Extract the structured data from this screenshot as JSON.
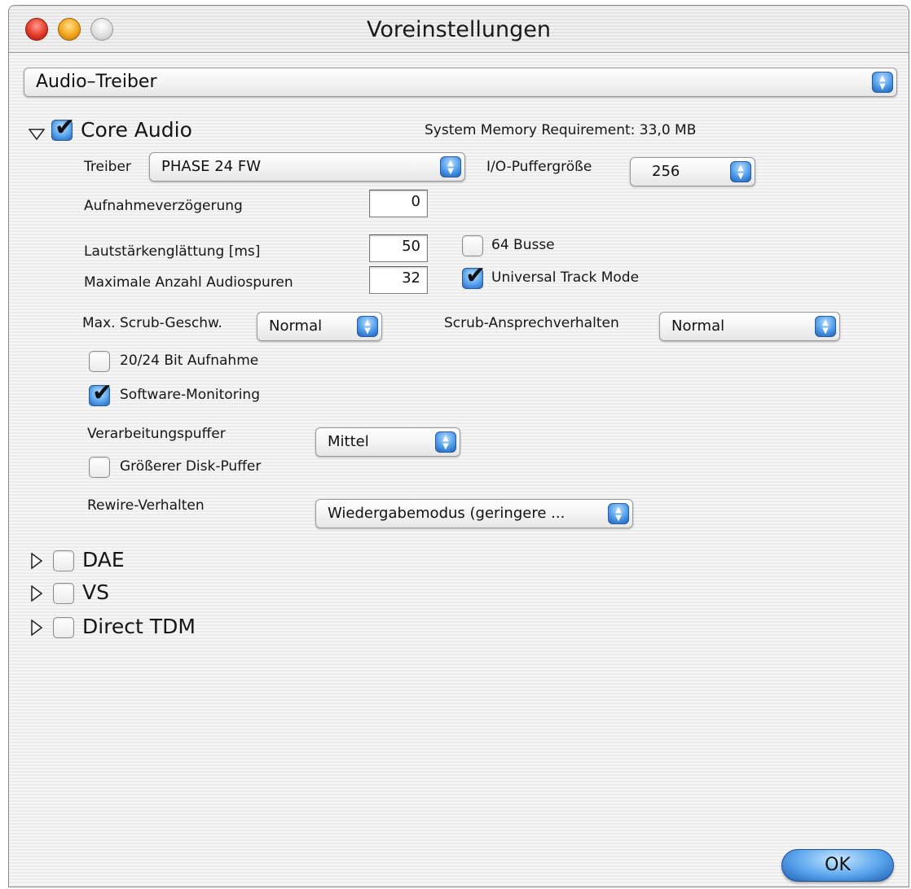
{
  "window": {
    "title": "Voreinstellungen"
  },
  "category_popup": {
    "value": "Audio–Treiber"
  },
  "core_audio": {
    "label": "Core Audio",
    "enabled": true,
    "memory": "System Memory Requirement: 33,0 MB",
    "driver_label": "Treiber",
    "driver_value": "PHASE 24 FW",
    "buffer_label": "I/O-Puffergröße",
    "buffer_value": "256",
    "record_delay_label": "Aufnahmeverzögerung",
    "record_delay_value": "0",
    "volume_smoothing_label": "Lautstärkenglättung [ms]",
    "volume_smoothing_value": "50",
    "max_tracks_label": "Maximale Anzahl Audiospuren",
    "max_tracks_value": "32",
    "busses_label": "64 Busse",
    "busses_checked": false,
    "universal_track_label": "Universal Track Mode",
    "universal_track_checked": true,
    "scrub_speed_label": "Max. Scrub-Geschw.",
    "scrub_speed_value": "Normal",
    "scrub_response_label": "Scrub-Ansprechverhalten",
    "scrub_response_value": "Normal",
    "bit_record_label": "20/24 Bit Aufnahme",
    "bit_record_checked": false,
    "software_monitoring_label": "Software-Monitoring",
    "software_monitoring_checked": true,
    "processing_buffer_label": "Verarbeitungspuffer",
    "processing_buffer_value": "Mittel",
    "disk_buffer_label": "Größerer Disk-Puffer",
    "disk_buffer_checked": false,
    "rewire_label": "Rewire-Verhalten",
    "rewire_value": "Wiedergabemodus (geringere ..."
  },
  "drivers": [
    {
      "label": "DAE",
      "enabled": false
    },
    {
      "label": "VS",
      "enabled": false
    },
    {
      "label": "Direct TDM",
      "enabled": false
    }
  ],
  "ok_button": {
    "label": "OK"
  },
  "icons": {
    "popup_arrows": "⬍",
    "checkmark": "✔"
  }
}
